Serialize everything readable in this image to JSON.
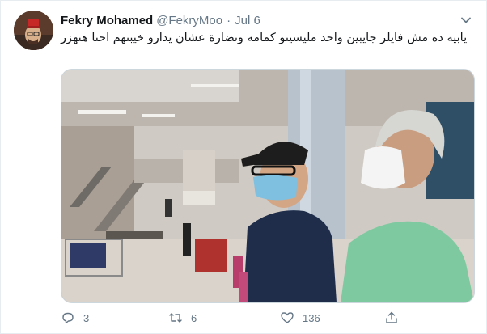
{
  "tweet": {
    "display_name": "Fekry Mohamed",
    "handle": "@FekryMoo",
    "separator": "·",
    "date": "Jul 6",
    "text": "يابيه ده مش فايلر جايبين واحد مليسينو كمامه ونضارة عشان يدارو خيبتهم احنا هنهزر"
  },
  "actions": {
    "replies": "3",
    "retweets": "6",
    "likes": "136"
  },
  "icons": {
    "menu": "chevron-down-icon",
    "reply": "reply-icon",
    "retweet": "retweet-icon",
    "like": "heart-icon",
    "share": "share-icon"
  },
  "colors": {
    "text": "#14171a",
    "secondary": "#657786",
    "border": "#e6ecf0"
  }
}
